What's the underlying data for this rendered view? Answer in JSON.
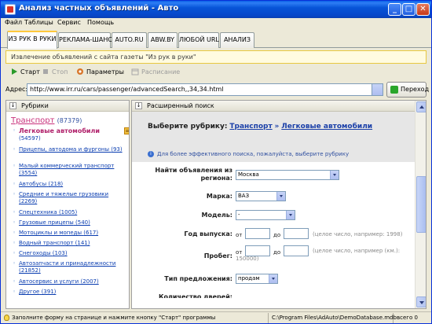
{
  "window": {
    "title": "Анализ частных объявлений - Авто",
    "controls": [
      "_",
      "□",
      "✕"
    ]
  },
  "menu": {
    "items": [
      "Файл",
      "Таблицы",
      "Сервис",
      "Помощь"
    ]
  },
  "tabs": [
    {
      "label": "ИЗ РУК В РУКИ",
      "active": true
    },
    {
      "label": "РЕКЛАМА-ШАНС",
      "active": false
    },
    {
      "label": "AUTO.RU",
      "active": false
    },
    {
      "label": "ABW.BY",
      "active": false
    },
    {
      "label": "ЛЮБОЙ URL",
      "active": false
    },
    {
      "label": "АНАЛИЗ",
      "active": false
    }
  ],
  "infobar": {
    "text": "Извлечение объявлений с сайта газеты \"Из рук в руки\""
  },
  "toolbar": {
    "start_label": "Старт",
    "stop_label": "Стоп",
    "params_label": "Параметры",
    "schedule_label": "Расписание"
  },
  "address": {
    "label": "Адрес:",
    "value": "http://www.irr.ru/cars/passenger/advancedSearch,,34,34.html",
    "go_label": "Переход"
  },
  "categories": {
    "header": "Рубрики",
    "root_label": "Транспорт",
    "root_count": "(87379)",
    "items": [
      {
        "label": "Легковые автомобили",
        "count": "(54597)",
        "selected": true
      },
      {
        "label": "Прицепы, автодома и фургоны",
        "count": "(93)"
      },
      {
        "label": "Малый коммерческий транспорт",
        "count": "(3554)"
      },
      {
        "label": "Автобусы",
        "count": "(218)"
      },
      {
        "label": "Средние и тяжелые грузовики",
        "count": "(2269)"
      },
      {
        "label": "Спецтехника",
        "count": "(1005)"
      },
      {
        "label": "Грузовые прицепы",
        "count": "(540)"
      },
      {
        "label": "Мотоциклы и мопеды",
        "count": "(617)"
      },
      {
        "label": "Водный транспорт",
        "count": "(141)"
      },
      {
        "label": "Снегоходы",
        "count": "(103)"
      },
      {
        "label": "Автозапчасти и принадлежности",
        "count": "(21852)"
      },
      {
        "label": "Автосервис и услуги",
        "count": "(2007)"
      },
      {
        "label": "Другое",
        "count": "(391)"
      }
    ]
  },
  "search": {
    "header": "Расширенный поиск",
    "rubric_label": "Выберите рубрику:",
    "crumb1": "Транспорт",
    "crumb_sep": "»",
    "crumb2": "Легковые автомобили",
    "hint": "Для более эффективного поиска, пожалуйста, выберите рубрику",
    "region_label": "Найти объявления из региона:",
    "region_value": "Москва",
    "brand_label": "Марка:",
    "brand_value": "ВАЗ",
    "model_label": "Модель:",
    "model_value": "-",
    "year_label": "Год выпуска:",
    "from": "от",
    "to": "до",
    "year_note": "(целое число, например: 1998)",
    "mileage_label": "Пробег:",
    "mileage_note_1": "(целое число, например (км.):",
    "mileage_note_2": "150000)",
    "offer_label": "Тип предложения:",
    "offer_value": "продам",
    "next_label": "Количество дверей:"
  },
  "status": {
    "hint": "Заполните форму на странице и нажмите кнопку \"Старт\" программы",
    "db_path": "C:\\Program Files\\AdAuto\\DemoDatabase.mdb",
    "count": "всего 0"
  }
}
